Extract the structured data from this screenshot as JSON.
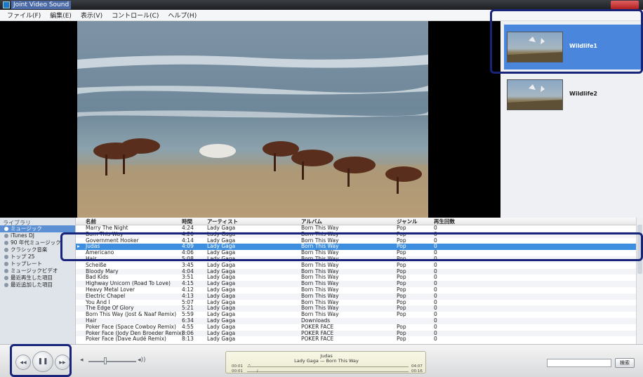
{
  "window": {
    "title": "Joint Video Sound"
  },
  "menu": [
    "ファイル(F)",
    "編集(E)",
    "表示(V)",
    "コントロール(C)",
    "ヘルプ(H)"
  ],
  "playlist": [
    {
      "label": "Wildlife1",
      "active": true
    },
    {
      "label": "Wildlife2",
      "active": false
    }
  ],
  "sidebar": {
    "header": "ライブラリ",
    "items": [
      {
        "label": "ミュージック",
        "selected": true
      },
      {
        "label": "iTunes DJ"
      },
      {
        "label": "90 年代ミュージック"
      },
      {
        "label": "クラシック音楽"
      },
      {
        "label": "トップ 25"
      },
      {
        "label": "トップレート"
      },
      {
        "label": "ミュージックビデオ"
      },
      {
        "label": "最近再生した項目"
      },
      {
        "label": "最近追加した項目"
      }
    ]
  },
  "table": {
    "columns": {
      "name": "名前",
      "time": "時間",
      "artist": "アーティスト",
      "album": "アルバム",
      "genre": "ジャンル",
      "plays": "再生回数"
    },
    "playing_icon": "▸",
    "rows": [
      {
        "name": "Marry The Night",
        "time": "4:24",
        "artist": "Lady Gaga",
        "album": "Born This Way",
        "genre": "Pop",
        "plays": "0"
      },
      {
        "name": "Born This Way",
        "time": "4:20",
        "artist": "Lady Gaga",
        "album": "Born This Way",
        "genre": "Pop",
        "plays": "0"
      },
      {
        "name": "Government Hooker",
        "time": "4:14",
        "artist": "Lady Gaga",
        "album": "Born This Way",
        "genre": "Pop",
        "plays": "0"
      },
      {
        "name": "Judas",
        "time": "4:09",
        "artist": "Lady Gaga",
        "album": "Born This Way",
        "genre": "Pop",
        "plays": "0",
        "selected": true
      },
      {
        "name": "Americano",
        "time": "4:06",
        "artist": "Lady Gaga",
        "album": "Born This Way",
        "genre": "Pop",
        "plays": "0"
      },
      {
        "name": "Hair",
        "time": "5:08",
        "artist": "Lady Gaga",
        "album": "Born This Way",
        "genre": "Pop",
        "plays": "0"
      },
      {
        "name": "Scheiße",
        "time": "3:45",
        "artist": "Lady Gaga",
        "album": "Born This Way",
        "genre": "Pop",
        "plays": "0"
      },
      {
        "name": "Bloody Mary",
        "time": "4:04",
        "artist": "Lady Gaga",
        "album": "Born This Way",
        "genre": "Pop",
        "plays": "0"
      },
      {
        "name": "Bad Kids",
        "time": "3:51",
        "artist": "Lady Gaga",
        "album": "Born This Way",
        "genre": "Pop",
        "plays": "0"
      },
      {
        "name": "Highway Unicorn (Road To Love)",
        "time": "4:15",
        "artist": "Lady Gaga",
        "album": "Born This Way",
        "genre": "Pop",
        "plays": "0"
      },
      {
        "name": "Heavy Metal Lover",
        "time": "4:12",
        "artist": "Lady Gaga",
        "album": "Born This Way",
        "genre": "Pop",
        "plays": "0"
      },
      {
        "name": "Electric Chapel",
        "time": "4:13",
        "artist": "Lady Gaga",
        "album": "Born This Way",
        "genre": "Pop",
        "plays": "0"
      },
      {
        "name": "You And I",
        "time": "5:07",
        "artist": "Lady Gaga",
        "album": "Born This Way",
        "genre": "Pop",
        "plays": "0"
      },
      {
        "name": "The Edge Of Glory",
        "time": "5:21",
        "artist": "Lady Gaga",
        "album": "Born This Way",
        "genre": "Pop",
        "plays": "0"
      },
      {
        "name": "Born This Way (Jost & Naaf Remix)",
        "time": "5:59",
        "artist": "Lady Gaga",
        "album": "Born This Way",
        "genre": "Pop",
        "plays": "0"
      },
      {
        "name": "Hair",
        "time": "6:34",
        "artist": "Lady Gaga",
        "album": "Downloads",
        "genre": "",
        "plays": "0"
      },
      {
        "name": "Poker Face (Space Cowboy Remix)",
        "time": "4:55",
        "artist": "Lady Gaga",
        "album": "POKER FACE",
        "genre": "Pop",
        "plays": "0"
      },
      {
        "name": "Poker Face (Jody Den Broeder Remix)",
        "time": "8:06",
        "artist": "Lady Gaga",
        "album": "POKER FACE",
        "genre": "Pop",
        "plays": "0"
      },
      {
        "name": "Poker Face (Dave Audé Remix)",
        "time": "8:13",
        "artist": "Lady Gaga",
        "album": "POKER FACE",
        "genre": "Pop",
        "plays": "0"
      }
    ]
  },
  "transport": {
    "prev_icon": "◀◀",
    "pause_icon": "❚❚",
    "next_icon": "▶▶",
    "vol_low_icon": "◂",
    "vol_high_icon": "◂))",
    "volume": 0.35
  },
  "now_playing": {
    "title": "Judas",
    "subtitle": "Lady Gaga — Born This Way",
    "elapsed1": "00:01",
    "total1": "04:07",
    "elapsed2": "00:01",
    "total2": "00:16",
    "progress1": 0.004,
    "progress2": 0.06
  },
  "search": {
    "value": "",
    "button": "検索"
  }
}
